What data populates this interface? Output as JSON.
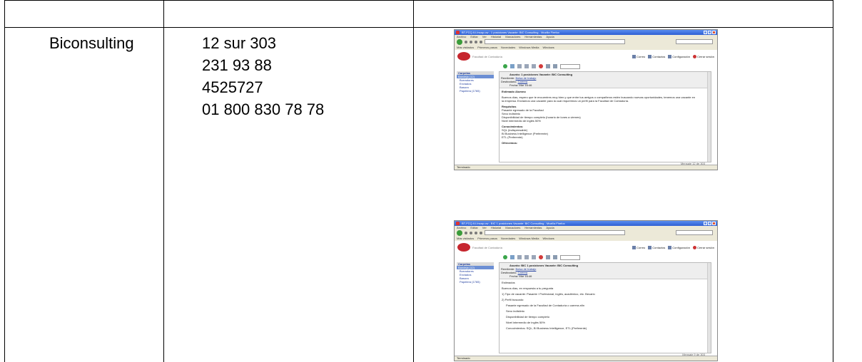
{
  "table": {
    "company": "Biconsulting",
    "contacts": [
      "12 sur 303",
      "231 93 88",
      "4525727",
      "01 800  830 78 78"
    ]
  },
  "screenshots": [
    {
      "window_title": "BT-FCQ-IU-Incap.uw - 1 posiciones Vacante: BIC Consulting - Mozilla Firefox",
      "menu": [
        "Archivo",
        "Editar",
        "Ver",
        "Historial",
        "Marcadores",
        "Herramientas",
        "Ayuda"
      ],
      "bookmarks": [
        "Más visitados",
        "Primeros pasos",
        "Novedades",
        "Windows Media",
        "Windows"
      ],
      "logo_text": "Facultad de Contaduría",
      "top_menu": [
        "Correo",
        "Contactos",
        "Configuración",
        "Cerrar sesión"
      ],
      "sidebar": {
        "title": "Carpetas",
        "selected": "Bandeja (12)",
        "items": [
          "Borradores",
          "Enviados",
          "Basura",
          "Papelera (1765)"
        ]
      },
      "meta": {
        "subject": "Asunto: 1 posiciones Vacante: BIC Consulting",
        "from_label": "Remitente:",
        "from": "Bolsa de trabajo",
        "to_label": "Destinatario:",
        "to": "Carrera",
        "date": "Fecha: Mar 16:46"
      },
      "body": [
        "Estimado Alumno",
        "",
        "Buenos días, espero que te encuentres muy bien y que entre tus amigos o compañeros estén buscando nuevas oportunidades, tenemos una vacante en",
        "la empresa. Enviamos una vacante para la cual requerimos un perfil para la Facultad de Contaduría.",
        "",
        "Requisitos",
        "Pasante egresado de la Facultad",
        "Sexo indistinto",
        "Disponibilidad de tiempo completo (horario de lunes a viernes)",
        "Nivel intermedio de inglés 50%",
        "",
        "Conocimientos:",
        "SQL (indispensable)",
        "BI Business Intelligence (Preferente)",
        "ETL (Preferente)",
        "",
        "Ofrecemos:"
      ],
      "footer": "Mensaje 12 de 303",
      "status": "Terminado"
    },
    {
      "window_title": "BT-FCQ-IU-Incap.uw - BIC 1 posiciones Vacante: BIC Consulting - Mozilla Firefox",
      "menu": [
        "Archivo",
        "Editar",
        "Ver",
        "Historial",
        "Marcadores",
        "Herramientas",
        "Ayuda"
      ],
      "bookmarks": [
        "Más visitados",
        "Primeros pasos",
        "Novedades",
        "Windows Media",
        "Windows"
      ],
      "logo_text": "Facultad de Contaduría",
      "top_menu": [
        "Correo",
        "Contactos",
        "Configuración",
        "Cerrar sesión"
      ],
      "sidebar": {
        "title": "Carpetas",
        "selected": "Bandeja (12)",
        "items": [
          "Borradores",
          "Enviados",
          "Basura",
          "Papelera (1765)"
        ]
      },
      "meta": {
        "subject": "Asunto: BIC 1 posiciones Vacante: BIC Consulting",
        "from_label": "Remitente:",
        "from": "Bolsa de trabajo",
        "to_label": "Destinatario:",
        "to": "Carrera",
        "date": "Fecha: Mar 16:46"
      },
      "body": [
        "Estimados",
        "",
        "Buenos días, en respuesta a tu pregunta",
        "",
        "1) Tipo de vacante: Pasante / Profesional, inglés, académico, etc. Becario",
        "",
        "2) Perfil buscado:",
        "",
        "Pasante egresado de la Facultad de Contaduría o carrera afín",
        "",
        "Sexo indistinto",
        "",
        "Disponibilidad de tiempo completo",
        "",
        "Nivel intermedio de inglés 50%",
        "",
        "Conocimientos: SQL, BI Business Intelligence, ETL (Preferente)"
      ],
      "footer": "Mensaje 9 de 303",
      "status": "Terminado"
    }
  ]
}
